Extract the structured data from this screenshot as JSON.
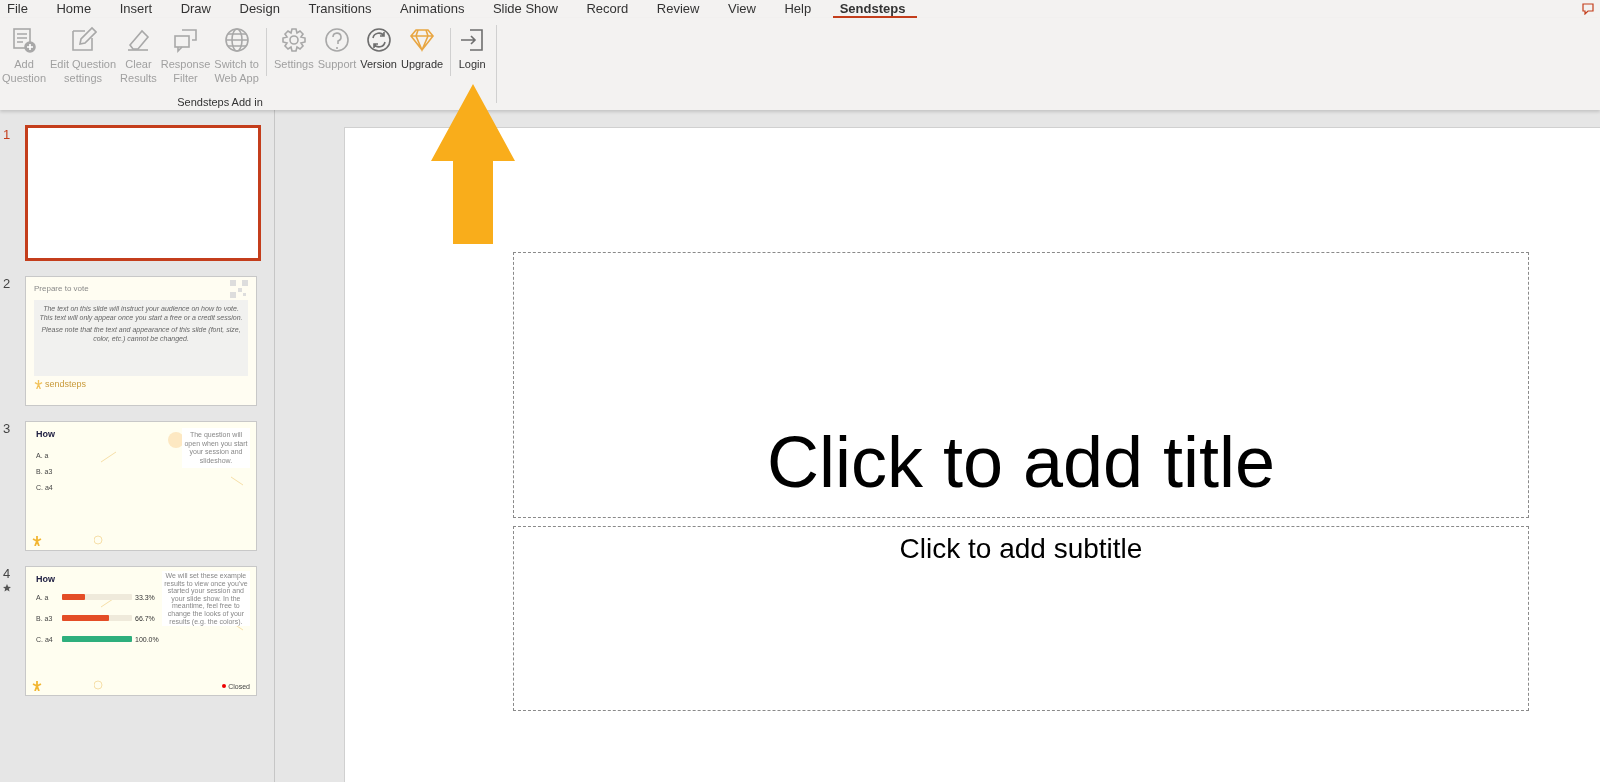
{
  "menu_tabs": [
    {
      "label": "File",
      "selected": false
    },
    {
      "label": "Home",
      "selected": false
    },
    {
      "label": "Insert",
      "selected": false
    },
    {
      "label": "Draw",
      "selected": false
    },
    {
      "label": "Design",
      "selected": false
    },
    {
      "label": "Transitions",
      "selected": false
    },
    {
      "label": "Animations",
      "selected": false
    },
    {
      "label": "Slide Show",
      "selected": false
    },
    {
      "label": "Record",
      "selected": false
    },
    {
      "label": "Review",
      "selected": false
    },
    {
      "label": "View",
      "selected": false
    },
    {
      "label": "Help",
      "selected": false
    },
    {
      "label": "Sendsteps",
      "selected": true
    }
  ],
  "ribbon": {
    "groups": [
      {
        "label": "Sendsteps Add in",
        "buttons": [
          {
            "label": "Add\nQuestion",
            "disabled": true,
            "separator_before": false
          },
          {
            "label": "Edit Question\nsettings",
            "disabled": true,
            "separator_before": false
          },
          {
            "label": "Clear\nResults",
            "disabled": true,
            "separator_before": false
          },
          {
            "label": "Response\nFilter",
            "disabled": true,
            "separator_before": false
          },
          {
            "label": "Switch to\nWeb App",
            "disabled": true,
            "separator_before": false
          },
          {
            "label": "Settings",
            "disabled": true,
            "separator_before": true
          },
          {
            "label": "Support",
            "disabled": true,
            "separator_before": false
          },
          {
            "label": "Version",
            "disabled": false,
            "separator_before": false
          },
          {
            "label": "Upgrade",
            "disabled": false,
            "separator_before": false
          },
          {
            "label": "Login",
            "disabled": false,
            "separator_before": true
          }
        ]
      }
    ]
  },
  "slides": [
    {
      "number": "1",
      "selected": true,
      "transition": false,
      "kind": "blank"
    },
    {
      "number": "2",
      "selected": false,
      "transition": false,
      "kind": "instructions",
      "title": "Prepare to vote",
      "paragraphs": [
        "The text on this slide will instruct your audience on how to vote. This text will only appear once you start a free or a credit session.",
        "Please note that the text and appearance of this slide (font, size, color, etc.) cannot be changed."
      ],
      "logo": "sendsteps"
    },
    {
      "number": "3",
      "selected": false,
      "transition": false,
      "kind": "question",
      "title": "How",
      "options": [
        {
          "letter": "A.",
          "text": "a"
        },
        {
          "letter": "B.",
          "text": "a3"
        },
        {
          "letter": "C.",
          "text": "a4"
        }
      ],
      "note": "The question will open when you start your session and slideshow."
    },
    {
      "number": "4",
      "selected": false,
      "transition": true,
      "kind": "results",
      "title": "How",
      "options": [
        {
          "letter": "A.",
          "text": "a",
          "level": 0.333,
          "reading": "33.3%",
          "color": "#e44d26"
        },
        {
          "letter": "B.",
          "text": "a3",
          "level": 0.667,
          "reading": "66.7%",
          "color": "#e44d26"
        },
        {
          "letter": "C.",
          "text": "a4",
          "level": 1,
          "reading": "100.0%",
          "color": "#2eaf7d"
        }
      ],
      "note": "We will set these example results to view once you've started your session and your slide show. In the meantime, feel free to change the looks of your results (e.g. the colors).",
      "status": "Closed"
    }
  ],
  "editor": {
    "title_placeholder": "Click to add title",
    "subtitle_placeholder": "Click to add subtitle"
  }
}
